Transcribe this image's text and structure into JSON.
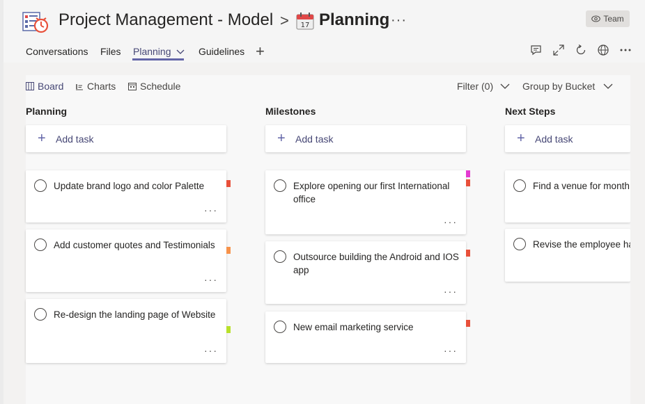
{
  "header": {
    "app_icon": "planner-app-icon",
    "title": "Project Management - Model",
    "separator": ">",
    "calendar_icon": "calendar-icon",
    "page_title": "Planning",
    "more": "···",
    "team_badge": "Team"
  },
  "tabs": [
    {
      "label": "Conversations"
    },
    {
      "label": "Files"
    },
    {
      "label": "Planning",
      "active": true
    },
    {
      "label": "Guidelines"
    }
  ],
  "tab_add": "+",
  "toolbar_icons": [
    "chat-icon",
    "expand-icon",
    "refresh-icon",
    "globe-icon",
    "more-icon"
  ],
  "views": [
    {
      "label": "Board",
      "icon": "board-icon",
      "active": true
    },
    {
      "label": "Charts",
      "icon": "charts-icon"
    },
    {
      "label": "Schedule",
      "icon": "schedule-icon"
    }
  ],
  "filter_label": "Filter (0)",
  "group_label": "Group by Bucket",
  "add_task_label": "Add task",
  "columns": [
    {
      "title": "Planning",
      "tasks": [
        {
          "text": "Update brand logo and color Palette",
          "flags": [
            "#e8503a"
          ]
        },
        {
          "text": "Add customer quotes and Testimonials",
          "flags": [
            "#f7924a"
          ]
        },
        {
          "text": "Re-design the landing page of Website",
          "flags": [
            "#b8e02a"
          ]
        }
      ]
    },
    {
      "title": "Milestones",
      "tasks": [
        {
          "text": "Explore opening our first International office",
          "flags": [
            "#e43ad1",
            "#e8503a"
          ]
        },
        {
          "text": "Outsource building the Android and IOS app",
          "flags": [
            "#e8503a"
          ]
        },
        {
          "text": "New email marketing service",
          "flags": [
            "#e8503a"
          ]
        }
      ]
    },
    {
      "title": "Next Steps",
      "tasks": [
        {
          "text": "Find a venue for month",
          "flags": []
        },
        {
          "text": "Revise the employee ha",
          "flags": []
        }
      ]
    }
  ],
  "card_more": "···",
  "colors": {
    "accent": "#6264a7",
    "accent_text": "#464775",
    "flag_red": "#e8503a",
    "flag_orange": "#f7924a",
    "flag_green": "#b8e02a",
    "flag_magenta": "#e43ad1"
  }
}
